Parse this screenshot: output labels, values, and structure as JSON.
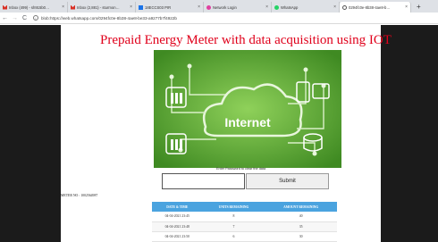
{
  "browser": {
    "tabs": [
      {
        "label": "Inbox (499) - sh915b0…",
        "icon_color": "#d93025",
        "icon": "gmail-icon"
      },
      {
        "label": "Inbox (2,881) - sturmon…",
        "icon_color": "#d93025",
        "icon": "gmail-icon"
      },
      {
        "label": "18ECCS03 PIR",
        "icon_color": "#1a73e8",
        "icon": "doc-icon"
      },
      {
        "label": "Network Login",
        "icon_color": "#e040a0",
        "icon": "heart-icon"
      },
      {
        "label": "WhatsApp",
        "icon_color": "#25d366",
        "icon": "whatsapp-icon"
      },
      {
        "label": "0294fc0e-8b38-4ae8-b…",
        "icon_color": "#555555",
        "icon": "globe-icon"
      }
    ],
    "active_tab_index": 5,
    "new_tab": "+",
    "url": "blob:https://web.whatsapp.com/0294fc0e-8b38-4ae8-be33-a9277b7f4922b"
  },
  "page": {
    "title": "Prepaid Energy Meter with data acquisition using IOT",
    "hero_label": "Internet",
    "password_caption": "Enter Password to clear the data",
    "password_value": "",
    "submit_label": "Submit",
    "meter_no_label": "METER NO : 1002564987",
    "table": {
      "headers": [
        "DATE & TIME",
        "UNITS REMAINING",
        "AMOUNT REMAINING"
      ],
      "rows": [
        [
          "04-04-2021 23:45",
          "8",
          "40"
        ],
        [
          "04-04-2021 23:48",
          "7",
          "35"
        ],
        [
          "04-04-2021 23:50",
          "6",
          "30"
        ]
      ]
    }
  },
  "colors": {
    "title_red": "#e0001b",
    "table_header_blue": "#4aa3df",
    "hero_green": "#5aa531",
    "side_panel": "#1b1b1b"
  }
}
